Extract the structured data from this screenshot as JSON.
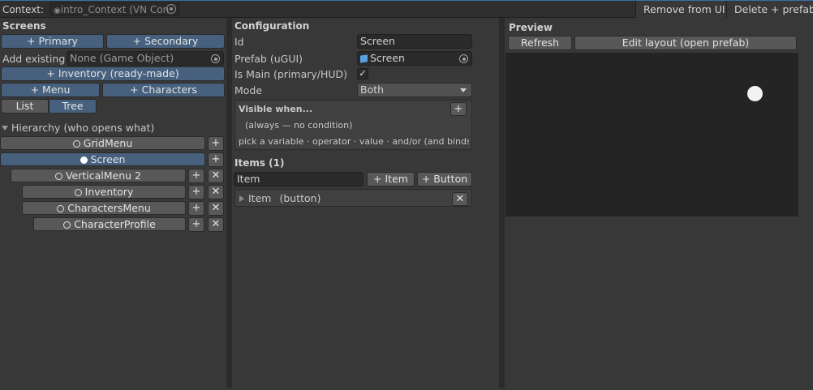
{
  "topbar": {
    "context_label": "Context:",
    "context_value": "intro_Context (VN Con",
    "remove_label": "Remove from UI",
    "delete_label": "Delete + prefab"
  },
  "screens": {
    "title": "Screens",
    "primary_label": "+ Primary",
    "secondary_label": "+ Secondary",
    "add_existing_label": "Add existing",
    "add_existing_value": "None (Game Object)",
    "inventory_label": "+ Inventory (ready-made)",
    "menu_label": "+ Menu",
    "characters_label": "+ Characters",
    "list_label": "List",
    "tree_label": "Tree",
    "hierarchy_label": "Hierarchy (who opens what)",
    "tree": [
      {
        "label": "GridMenu",
        "selected": false
      },
      {
        "label": "Screen",
        "selected": true
      },
      {
        "label": "VerticalMenu 2",
        "selected": false
      },
      {
        "label": "Inventory",
        "selected": false
      },
      {
        "label": "CharactersMenu",
        "selected": false
      },
      {
        "label": "CharacterProfile",
        "selected": false
      }
    ],
    "plus": "+",
    "x": "✕"
  },
  "config": {
    "title": "Configuration",
    "id_label": "Id",
    "id_value": "Screen",
    "prefab_label": "Prefab (uGUI)",
    "prefab_value": "Screen",
    "is_main_label": "Is Main (primary/HUD)",
    "is_main_checked": "✓",
    "mode_label": "Mode",
    "mode_value": "Both",
    "visible_title": "Visible when...",
    "visible_plus": "+",
    "visible_condition": "(always — no condition)",
    "visible_hint": "pick a variable · operator · value · and/or  (and binds before or)",
    "items_title": "Items (1)",
    "item_input": "Item",
    "add_item_label": "+ Item",
    "add_button_label": "+ Button",
    "item_row_name": "Item",
    "item_row_type": "(button)",
    "item_remove": "✕"
  },
  "preview": {
    "title": "Preview",
    "refresh_label": "Refresh",
    "edit_layout_label": "Edit layout (open prefab)"
  },
  "colors": {
    "accent": "#46607e",
    "background": "#383838",
    "preview_bg": "#242424"
  }
}
